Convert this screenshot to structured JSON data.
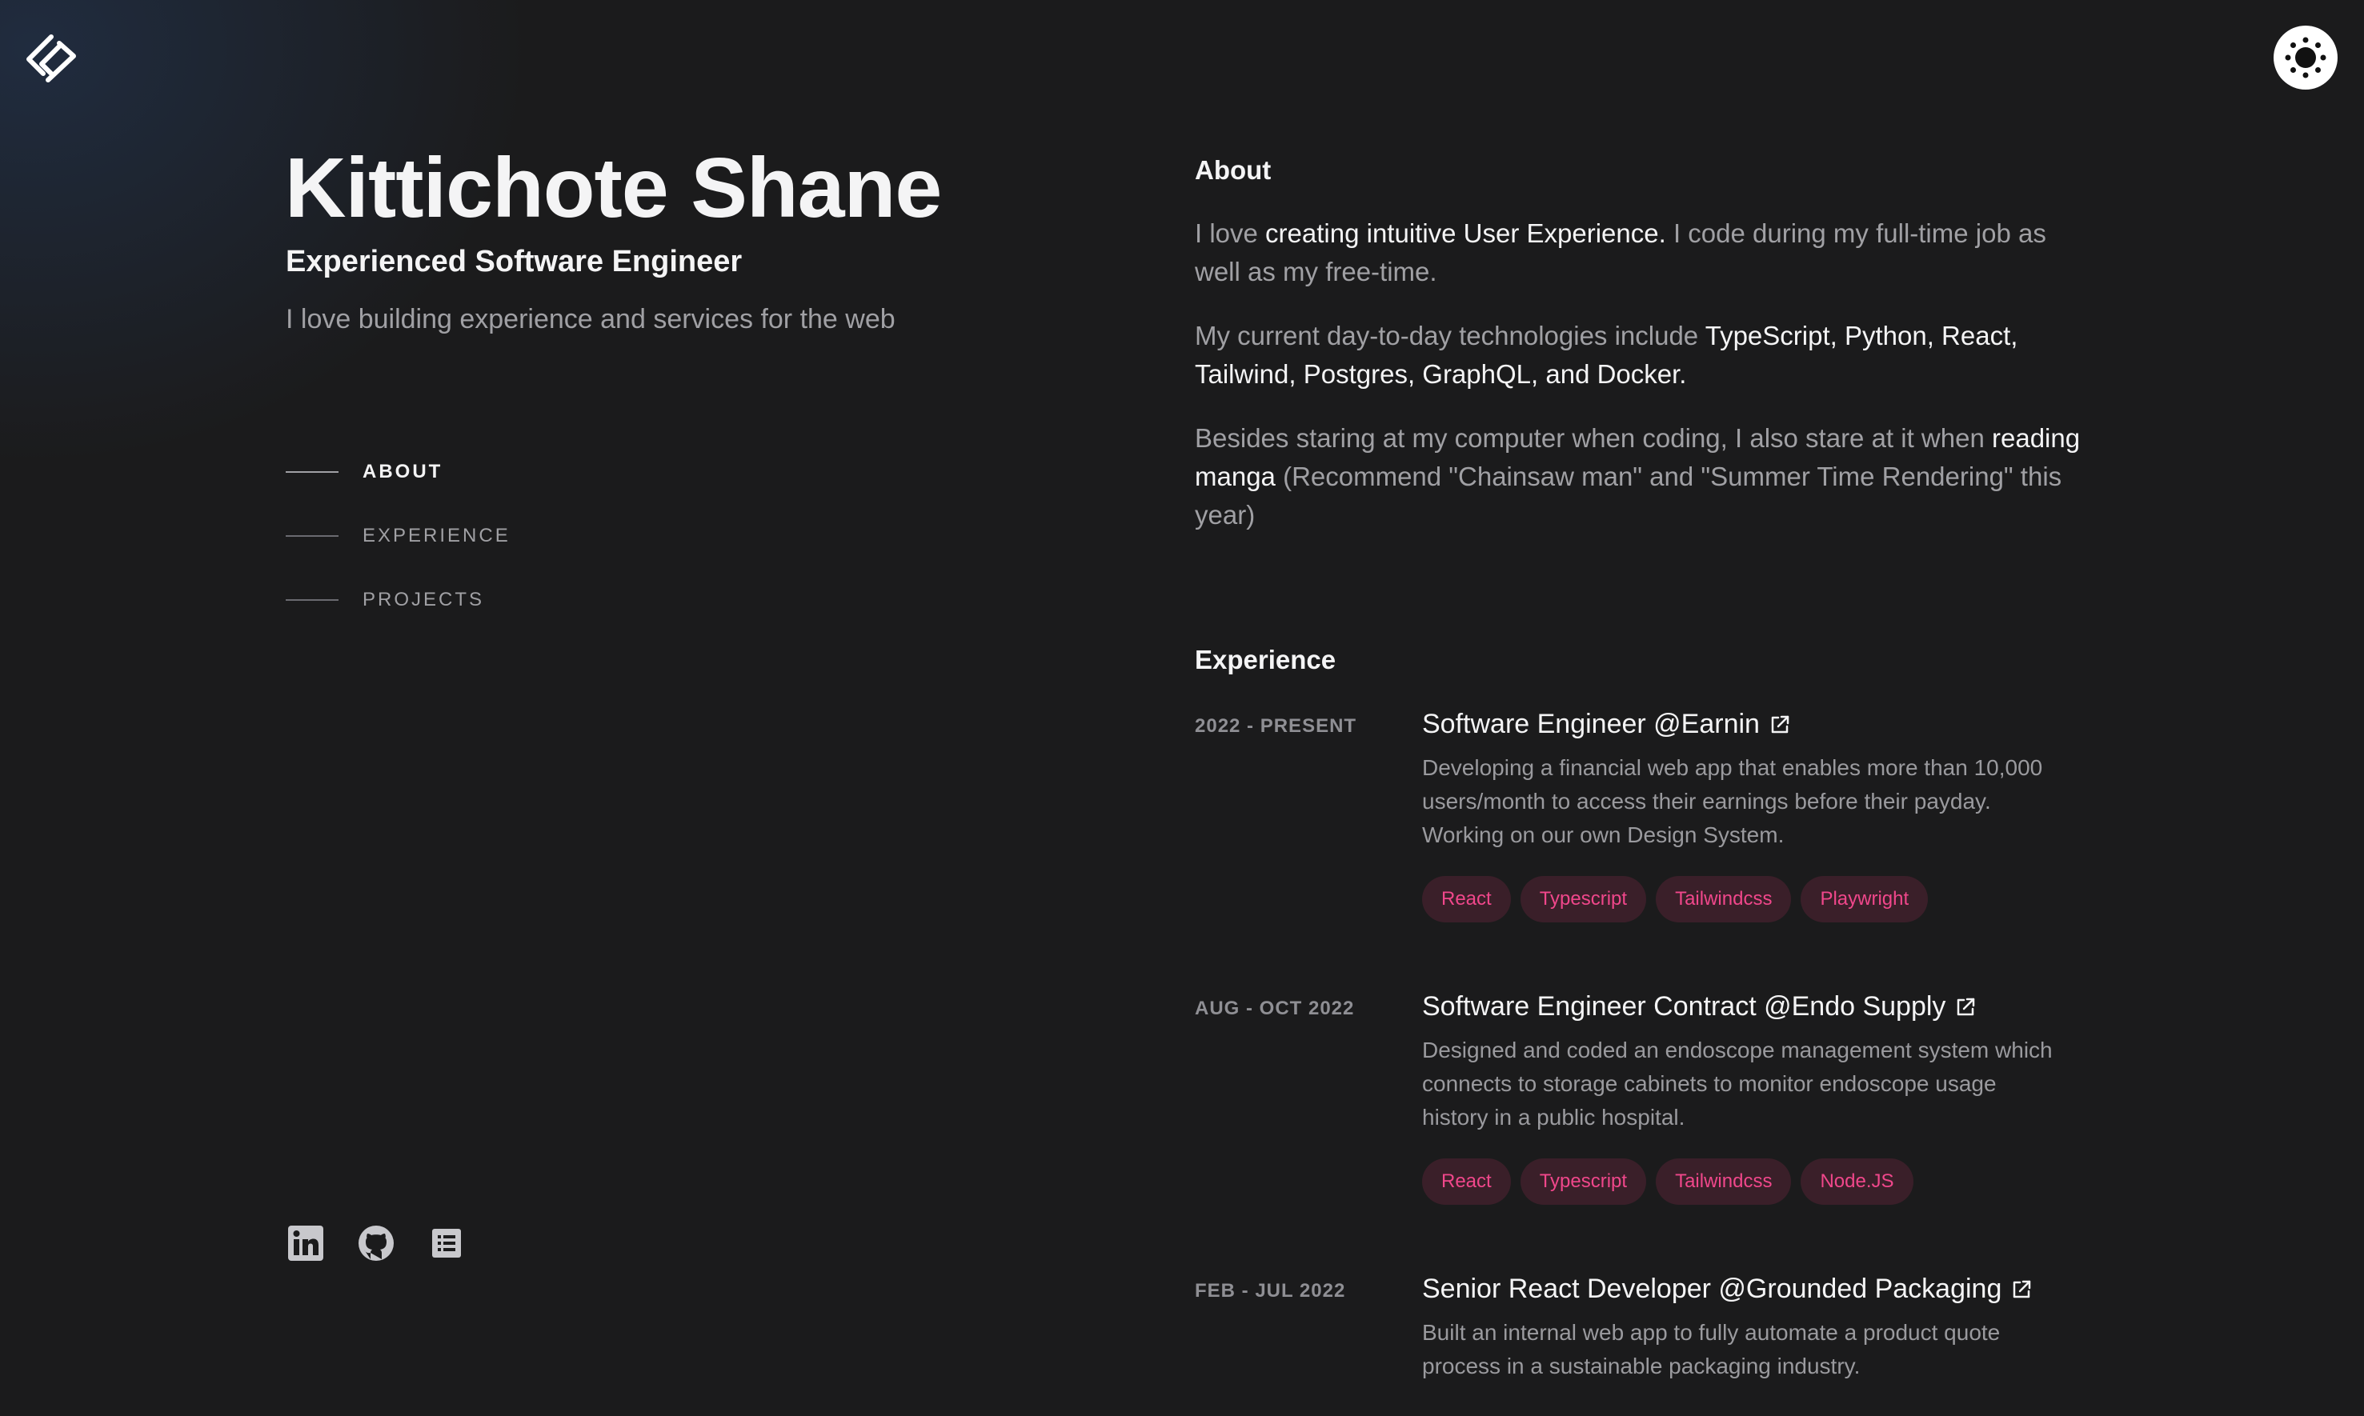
{
  "header": {
    "logo_icon": "brand-logo-icon",
    "theme_toggle_icon": "sun-icon"
  },
  "profile": {
    "name": "Kittichote Shane",
    "role": "Experienced Software Engineer",
    "tagline": "I love building experience and services for the web"
  },
  "nav": {
    "items": [
      {
        "label": "ABOUT",
        "active": true
      },
      {
        "label": "EXPERIENCE",
        "active": false
      },
      {
        "label": "PROJECTS",
        "active": false
      }
    ]
  },
  "socials": [
    {
      "icon": "linkedin-icon"
    },
    {
      "icon": "github-icon"
    },
    {
      "icon": "resume-icon"
    }
  ],
  "about": {
    "title": "About",
    "p1": {
      "a": "I love ",
      "b": "creating intuitive User Experience.",
      "c": " I code during my full-time job as well as my free-time."
    },
    "p2": {
      "a": "My current day-to-day technologies include ",
      "b": "TypeScript, Python, React, Tailwind, Postgres, GraphQL, and Docker."
    },
    "p3": {
      "a": "Besides staring at my computer when coding, I also stare at it when ",
      "b": "reading manga",
      "c": " (Recommend \"Chainsaw man\" and \"Summer Time Rendering\" this year)"
    }
  },
  "experience": {
    "title": "Experience",
    "items": [
      {
        "date": "2022 - PRESENT",
        "role": "Software Engineer @Earnin",
        "description": "Developing a financial web app that enables more than 10,000 users/month to access their earnings before their payday. Working on our own Design System.",
        "tags": [
          "React",
          "Typescript",
          "Tailwindcss",
          "Playwright"
        ]
      },
      {
        "date": "AUG - OCT 2022",
        "role": "Software Engineer Contract @Endo Supply",
        "description": "Designed and coded an endoscope management system which connects to storage cabinets to monitor endoscope usage history in a public hospital.",
        "tags": [
          "React",
          "Typescript",
          "Tailwindcss",
          "Node.JS"
        ]
      },
      {
        "date": "FEB - JUL 2022",
        "role": "Senior React Developer @Grounded Packaging",
        "description": "Built an internal web app to fully automate a product quote process in a sustainable packaging industry.",
        "tags": []
      }
    ]
  },
  "colors": {
    "background": "#1b1b1c",
    "heading": "#f4f4f5",
    "body_text": "#a0a0a4",
    "tag_bg": "#3a1f29",
    "tag_text": "#f0478b"
  }
}
